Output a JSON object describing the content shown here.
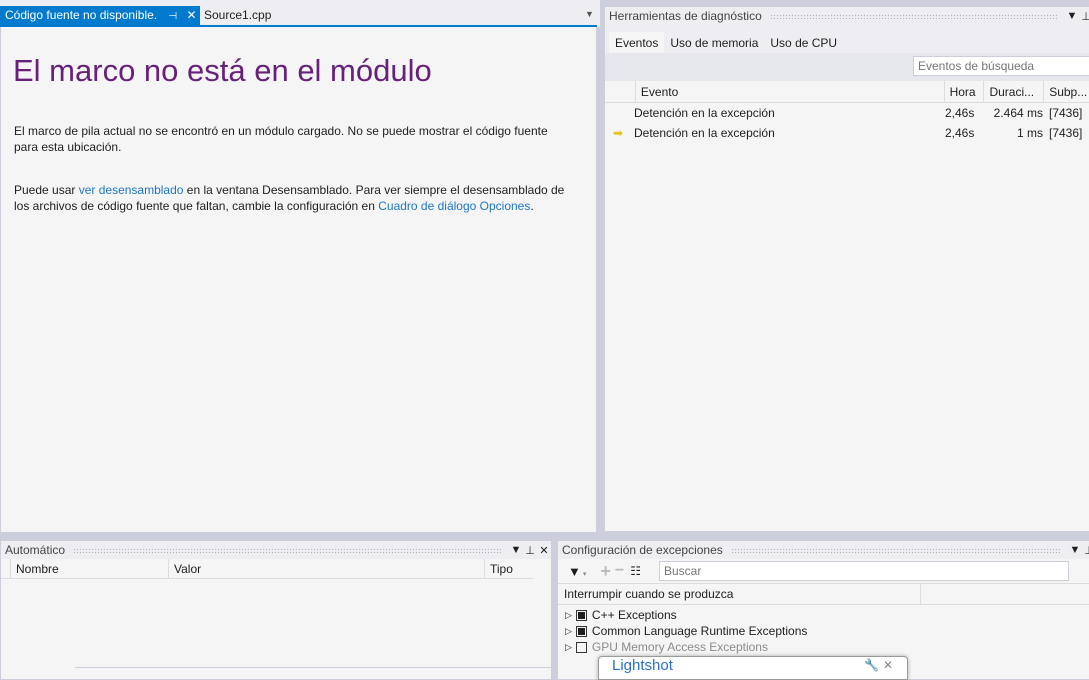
{
  "document_tabs": [
    {
      "label": "Código fuente no disponible.",
      "active": true
    },
    {
      "label": "Source1.cpp",
      "active": false
    }
  ],
  "document": {
    "title": "El marco no está en el módulo",
    "para1": "El marco de pila actual no se encontró en un módulo cargado. No se puede mostrar el código fuente para esta ubicación.",
    "para2_pre": "Puede usar ",
    "para2_link1": "ver desensamblado",
    "para2_mid": " en la ventana Desensamblado. Para ver siempre el desensamblado de los archivos de código fuente que faltan, cambie la configuración en ",
    "para2_link2": "Cuadro de diálogo Opciones",
    "para2_post": "."
  },
  "diagnostics": {
    "title": "Herramientas de diagnóstico",
    "tabs": [
      "Eventos",
      "Uso de memoria",
      "Uso de CPU"
    ],
    "search_placeholder": "Eventos de búsqueda",
    "columns": [
      "Evento",
      "Hora",
      "Duraci...",
      "Subp..."
    ],
    "rows": [
      {
        "icon": "",
        "event": "Detención en la excepción",
        "time": "2,46s",
        "duration": "2.464 ms",
        "thread": "[7436]"
      },
      {
        "icon": "current-arrow-icon",
        "event": "Detención en la excepción",
        "time": "2,46s",
        "duration": "1 ms",
        "thread": "[7436]"
      }
    ]
  },
  "autos": {
    "title": "Automático",
    "columns": [
      "Nombre",
      "Valor",
      "Tipo"
    ]
  },
  "exceptions": {
    "title": "Configuración de excepciones",
    "search_placeholder": "Buscar",
    "column": "Interrumpir cuando se produzca",
    "items": [
      {
        "label": "C++ Exceptions",
        "checked": true
      },
      {
        "label": "Common Language Runtime Exceptions",
        "checked": true
      },
      {
        "label": "GPU Memory Access Exceptions",
        "checked": false
      }
    ]
  },
  "lightshot": {
    "title": "Lightshot"
  },
  "colors": {
    "accent": "#007acc",
    "title": "#68217a",
    "link": "#1e75c8"
  }
}
